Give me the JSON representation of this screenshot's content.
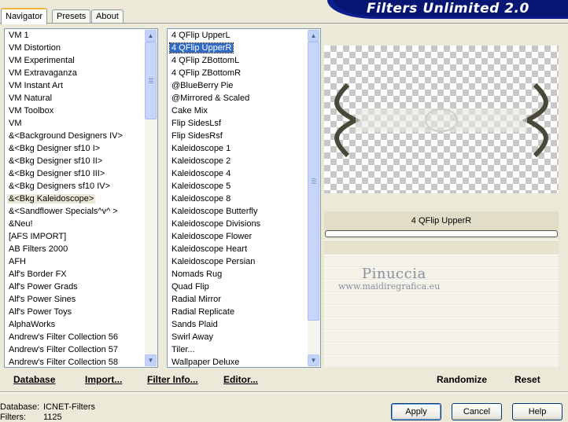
{
  "app": {
    "title": "Filters Unlimited 2.0"
  },
  "tabs": [
    {
      "label": "Navigator",
      "active": true
    },
    {
      "label": "Presets",
      "active": false
    },
    {
      "label": "About",
      "active": false
    }
  ],
  "categories": {
    "items": [
      "VM 1",
      "VM Distortion",
      "VM Experimental",
      "VM Extravaganza",
      "VM Instant Art",
      "VM Natural",
      "VM Toolbox",
      "VM",
      "&<Background Designers IV>",
      "&<Bkg Designer sf10 I>",
      "&<Bkg Designer sf10 II>",
      "&<Bkg Designer sf10 III>",
      "&<Bkg Designers sf10 IV>",
      "&<Bkg Kaleidoscope>",
      "&<Sandflower Specials^v^ >",
      "&Neu!",
      "[AFS IMPORT]",
      "AB Filters 2000",
      "AFH",
      "Alf's Border FX",
      "Alf's Power Grads",
      "Alf's Power Sines",
      "Alf's Power Toys",
      "AlphaWorks",
      "Andrew's Filter Collection 56",
      "Andrew's Filter Collection 57",
      "Andrew's Filter Collection 58"
    ],
    "highlighted_index": 13
  },
  "filters": {
    "items": [
      "4 QFlip UpperL",
      "4 QFlip UpperR",
      "4 QFlip ZBottomL",
      "4 QFlip ZBottomR",
      "@BlueBerry Pie",
      "@Mirrored & Scaled",
      "Cake Mix",
      "Flip SidesLsf",
      "Flip SidesRsf",
      "Kaleidoscope 1",
      "Kaleidoscope 2",
      "Kaleidoscope 4",
      "Kaleidoscope 5",
      "Kaleidoscope 8",
      "Kaleidoscope Butterfly",
      "Kaleidoscope Divisions",
      "Kaleidoscope Flower",
      "Kaleidoscope Heart",
      "Kaleidoscope Persian",
      "Nomads Rug",
      "Quad Flip",
      "Radial Mirror",
      "Radial Replicate",
      "Sands Plaid",
      "Swirl Away",
      "Tiler...",
      "Wallpaper Deluxe"
    ],
    "selected_index": 1
  },
  "preview": {
    "selected_filter": "4 QFlip UpperR",
    "watermark_name": "Pinuccia",
    "watermark_url": "www.maidiregrafica.eu"
  },
  "actions": {
    "database": "Database",
    "import": "Import...",
    "filter_info": "Filter Info...",
    "editor": "Editor...",
    "randomize": "Randomize",
    "reset": "Reset"
  },
  "footer": {
    "database_label": "Database:",
    "database_value": "ICNET-Filters",
    "filters_label": "Filters:",
    "filters_value": "1125",
    "apply": "Apply",
    "cancel": "Cancel",
    "help": "Help"
  },
  "colors": {
    "selection": "#316ac5",
    "banner": "#0e1d8e",
    "dialog_bg": "#ece9d8"
  }
}
